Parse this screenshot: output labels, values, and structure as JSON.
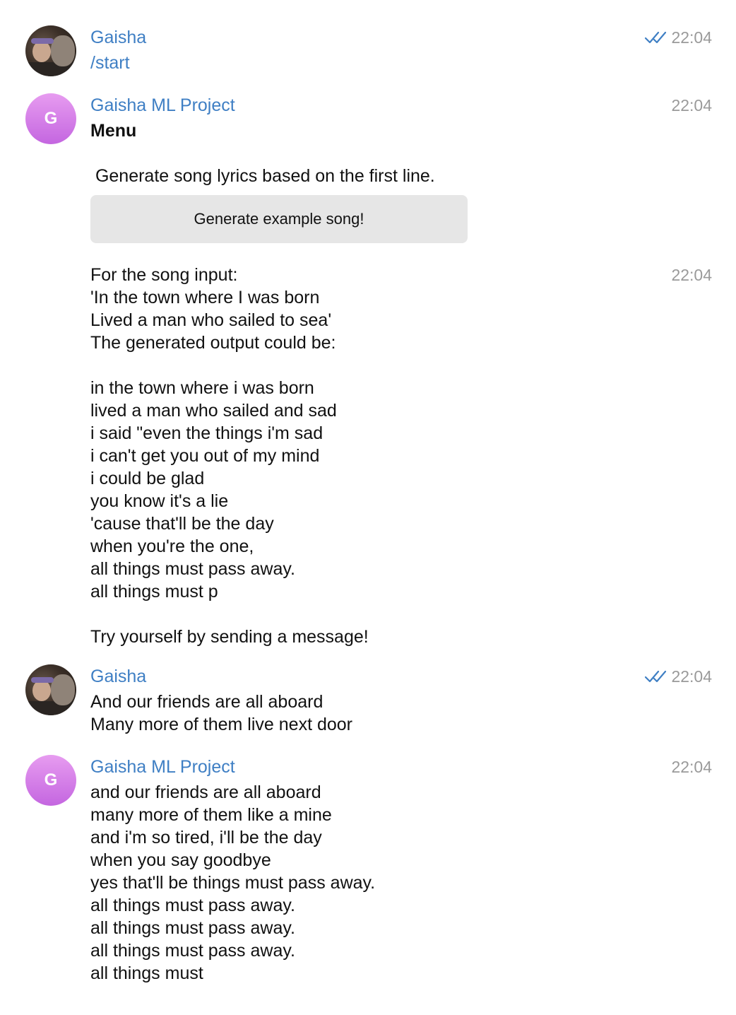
{
  "messages": [
    {
      "sender": "Gaisha",
      "time": "22:04",
      "read": true,
      "text": "/start"
    },
    {
      "sender": "Gaisha ML Project",
      "avatar_letter": "G",
      "time": "22:04",
      "title": "Menu",
      "text": " Generate song lyrics based on the first line.",
      "button_label": "Generate example song!"
    },
    {
      "time": "22:04",
      "text": "For the song input:\n'In the town where I was born\nLived a man who sailed to sea'\nThe generated output could be:\n\nin the town where i was born\nlived a man who sailed and sad\ni said \"even the things i'm sad\ni can't get you out of my mind\ni could be glad\nyou know it's a lie\n'cause that'll be the day\nwhen you're the one,\nall things must pass away.\nall things must p\n\nTry yourself by sending a message!"
    },
    {
      "sender": "Gaisha",
      "time": "22:04",
      "read": true,
      "text": "And our friends are all aboard\nMany more of them live next door"
    },
    {
      "sender": "Gaisha ML Project",
      "avatar_letter": "G",
      "time": "22:04",
      "text": "and our friends are all aboard\nmany more of them like a mine\nand i'm so tired, i'll be the day\nwhen you say goodbye\nyes that'll be things must pass away.\nall things must pass away.\nall things must pass away.\nall things must pass away.\nall things must"
    }
  ],
  "colors": {
    "sender_name": "#3f7fc4",
    "timestamp": "#9a9a9a",
    "read_check": "#3f7fc4",
    "bot_avatar": "#d17ee8",
    "button_bg": "#e6e6e6"
  },
  "icons": {
    "read_receipt": "double-check-icon"
  }
}
